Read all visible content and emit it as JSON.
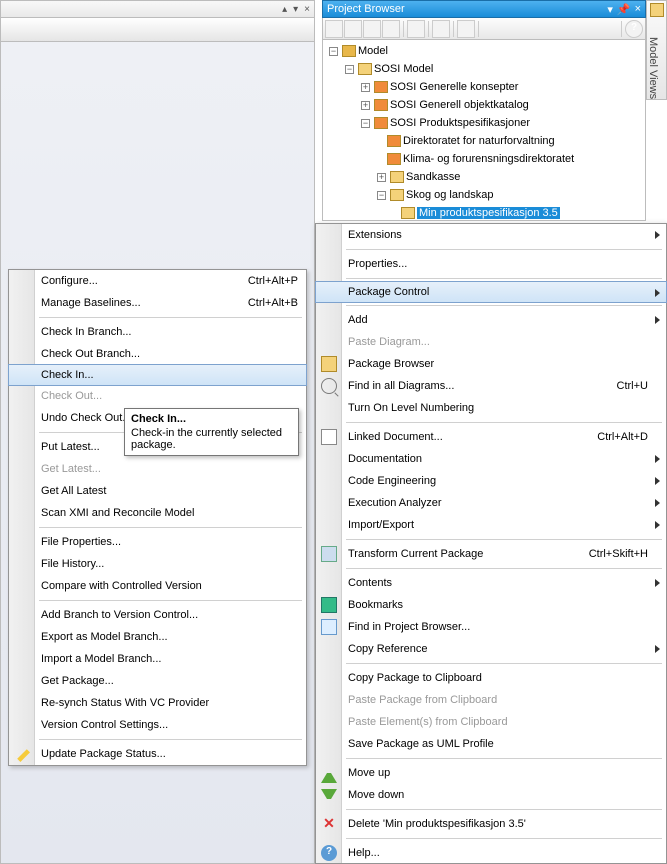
{
  "project_browser": {
    "title": "Project Browser",
    "side_tab": "Model Views",
    "tree": {
      "root": "Model",
      "l1": "SOSI Model",
      "l2a": "SOSI Generelle konsepter",
      "l2b": "SOSI Generell objektkatalog",
      "l2c": "SOSI Produktspesifikasjoner",
      "l3a": "Direktoratet for naturforvaltning",
      "l3b": "Klima- og forurensningsdirektoratet",
      "l3c": "Sandkasse",
      "l3d": "Skog og landskap",
      "l4": "Min produktspesifikasjon 3.5"
    }
  },
  "context_menu": [
    {
      "label": "Extensions",
      "submenu": true
    },
    {
      "sep": true
    },
    {
      "label": "Properties..."
    },
    {
      "sep": true
    },
    {
      "label": "Package Control",
      "submenu": true,
      "highlight": true
    },
    {
      "sep": true
    },
    {
      "label": "Add",
      "submenu": true
    },
    {
      "label": "Paste Diagram...",
      "disabled": true
    },
    {
      "label": "Package Browser",
      "icon": "pkg"
    },
    {
      "label": "Find in all Diagrams...",
      "shortcut": "Ctrl+U",
      "icon": "find"
    },
    {
      "label": "Turn On Level Numbering"
    },
    {
      "sep": true
    },
    {
      "label": "Linked Document...",
      "shortcut": "Ctrl+Alt+D",
      "icon": "doc"
    },
    {
      "label": "Documentation",
      "submenu": true
    },
    {
      "label": "Code Engineering",
      "submenu": true
    },
    {
      "label": "Execution Analyzer",
      "submenu": true
    },
    {
      "label": "Import/Export",
      "submenu": true
    },
    {
      "sep": true
    },
    {
      "label": "Transform Current Package",
      "shortcut": "Ctrl+Skift+H",
      "icon": "trans"
    },
    {
      "sep": true
    },
    {
      "label": "Contents",
      "submenu": true
    },
    {
      "label": "Bookmarks",
      "icon": "book"
    },
    {
      "label": "Find in Project Browser...",
      "icon": "fpb"
    },
    {
      "label": "Copy Reference",
      "submenu": true
    },
    {
      "sep": true
    },
    {
      "label": "Copy Package to Clipboard"
    },
    {
      "label": "Paste Package from Clipboard",
      "disabled": true
    },
    {
      "label": "Paste Element(s) from Clipboard",
      "disabled": true
    },
    {
      "label": "Save Package as UML Profile"
    },
    {
      "sep": true
    },
    {
      "label": "Move up",
      "icon": "up"
    },
    {
      "label": "Move down",
      "icon": "down"
    },
    {
      "sep": true
    },
    {
      "label": "Delete 'Min produktspesifikasjon 3.5'",
      "icon": "del"
    },
    {
      "sep": true
    },
    {
      "label": "Help...",
      "icon": "help"
    }
  ],
  "submenu": [
    {
      "label": "Configure...",
      "shortcut": "Ctrl+Alt+P"
    },
    {
      "label": "Manage Baselines...",
      "shortcut": "Ctrl+Alt+B"
    },
    {
      "sep": true
    },
    {
      "label": "Check In Branch..."
    },
    {
      "label": "Check Out Branch..."
    },
    {
      "label": "Check In...",
      "highlight": true
    },
    {
      "label": "Check Out...",
      "disabled": true
    },
    {
      "label": "Undo Check Out..."
    },
    {
      "sep": true
    },
    {
      "label": "Put Latest..."
    },
    {
      "label": "Get Latest...",
      "disabled": true
    },
    {
      "label": "Get All Latest"
    },
    {
      "label": "Scan XMI and Reconcile Model"
    },
    {
      "sep": true
    },
    {
      "label": "File Properties..."
    },
    {
      "label": "File History..."
    },
    {
      "label": "Compare with Controlled Version"
    },
    {
      "sep": true
    },
    {
      "label": "Add Branch to Version Control..."
    },
    {
      "label": "Export as Model Branch..."
    },
    {
      "label": "Import a Model Branch..."
    },
    {
      "label": "Get Package..."
    },
    {
      "label": "Re-synch Status With VC Provider"
    },
    {
      "label": "Version Control Settings..."
    },
    {
      "sep": true
    },
    {
      "label": "Update Package Status...",
      "icon": "pencil"
    }
  ],
  "tooltip": {
    "title": "Check In...",
    "body": "Check-in the currently selected package."
  }
}
